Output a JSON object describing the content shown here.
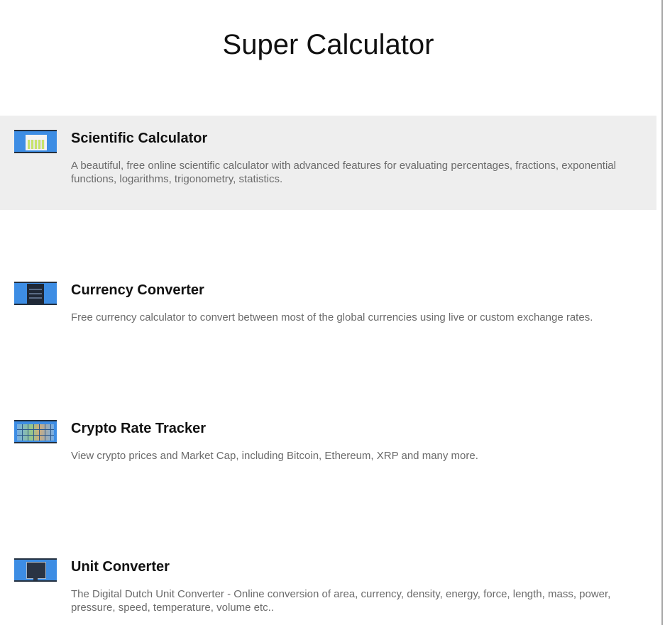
{
  "page": {
    "title": "Super Calculator"
  },
  "apps": [
    {
      "title": "Scientific Calculator",
      "description": "A beautiful, free online scientific calculator with advanced features for evaluating percentages, fractions, exponential functions, logarithms, trigonometry, statistics.",
      "thumbnail_icon": "calculator-thumbnail-icon",
      "highlighted": true
    },
    {
      "title": "Currency Converter",
      "description": "Free currency calculator to convert between most of the global currencies using live or custom exchange rates.",
      "thumbnail_icon": "currency-converter-thumbnail-icon",
      "highlighted": false
    },
    {
      "title": "Crypto Rate Tracker",
      "description": "View crypto prices and Market Cap, including Bitcoin, Ethereum, XRP and many more.",
      "thumbnail_icon": "crypto-tracker-thumbnail-icon",
      "highlighted": false
    },
    {
      "title": "Unit Converter",
      "description": "The Digital Dutch Unit Converter - Online conversion of area, currency, density, energy, force, length, mass, power, pressure, speed, temperature, volume etc..",
      "thumbnail_icon": "unit-converter-thumbnail-icon",
      "highlighted": false
    }
  ],
  "colors": {
    "highlight_background": "#eeeeee",
    "thumbnail_blue": "#3d8de4",
    "description_text": "#6b6b6b",
    "title_text": "#111111"
  }
}
